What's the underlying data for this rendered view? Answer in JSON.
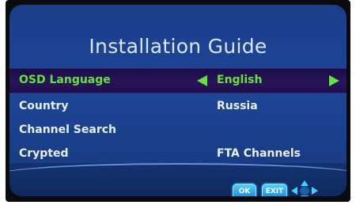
{
  "title": "Installation Guide",
  "rows": [
    {
      "label": "OSD Language",
      "value": "English",
      "selected": true
    },
    {
      "label": "Country",
      "value": "Russia",
      "selected": false
    },
    {
      "label": "Channel Search",
      "value": "",
      "selected": false
    },
    {
      "label": "Crypted",
      "value": "FTA Channels",
      "selected": false
    }
  ],
  "footer": {
    "ok_label": "OK",
    "exit_label": "EXIT",
    "nav_icon": "dpad-icon"
  },
  "colors": {
    "background": "#1d4696",
    "selected_row": "#2a145c",
    "selected_text": "#66e03a",
    "title_text": "#d8e6ff",
    "button": "#1b86d9"
  }
}
